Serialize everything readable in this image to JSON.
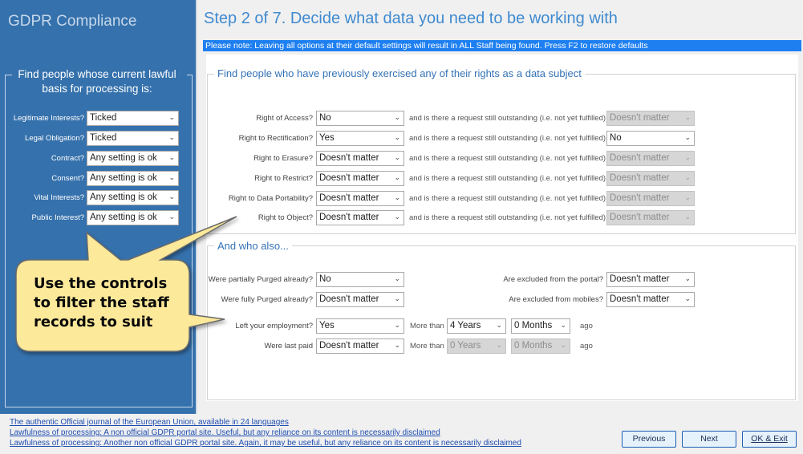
{
  "app": {
    "title": "GDPR Compliance"
  },
  "step": {
    "title": "Step 2 of 7. Decide what data you need to be working with",
    "note": "Please note: Leaving all options at their default settings will result in ALL Staff being found. Press F2 to restore defaults"
  },
  "sidebar": {
    "heading_line1": "Find people whose current lawful",
    "heading_line2": "basis for processing is:",
    "rows": [
      {
        "label": "Legitimate Interests?",
        "value": "Ticked"
      },
      {
        "label": "Legal Obligation?",
        "value": "Ticked"
      },
      {
        "label": "Contract?",
        "value": "Any setting is ok"
      },
      {
        "label": "Consent?",
        "value": "Any setting is ok"
      },
      {
        "label": "Vital Interests?",
        "value": "Any setting is ok"
      },
      {
        "label": "Public Interest?",
        "value": "Any setting is ok"
      }
    ]
  },
  "rights": {
    "title": "Find people who have previously exercised any of their rights as a data subject",
    "outstanding_text": "and is there a request still outstanding (i.e. not yet fulfilled)",
    "rows": [
      {
        "label": "Right of Access?",
        "value": "No",
        "outstanding": "Doesn't matter",
        "outstanding_disabled": true
      },
      {
        "label": "Right to Rectification?",
        "value": "Yes",
        "outstanding": "No",
        "outstanding_disabled": false
      },
      {
        "label": "Right to Erasure?",
        "value": "Doesn't matter",
        "outstanding": "Doesn't matter",
        "outstanding_disabled": true
      },
      {
        "label": "Right to Restrict?",
        "value": "Doesn't matter",
        "outstanding": "Doesn't matter",
        "outstanding_disabled": true
      },
      {
        "label": "Right to Data Portability?",
        "value": "Doesn't matter",
        "outstanding": "Doesn't matter",
        "outstanding_disabled": true
      },
      {
        "label": "Right to Object?",
        "value": "Doesn't matter",
        "outstanding": "Doesn't matter",
        "outstanding_disabled": true
      }
    ]
  },
  "also": {
    "title": "And who also...",
    "partially_purged": {
      "label": "Were partially Purged already?",
      "value": "No"
    },
    "fully_purged": {
      "label": "Were fully Purged already?",
      "value": "Doesn't matter"
    },
    "excluded_portal": {
      "label": "Are excluded from the portal?",
      "value": "Doesn't matter"
    },
    "excluded_mobiles": {
      "label": "Are excluded from mobiles?",
      "value": "Doesn't matter"
    },
    "left_employment": {
      "label": "Left your employment?",
      "value": "Yes",
      "more_than": "More than",
      "years": "4 Years",
      "months": "0 Months",
      "ago": "ago"
    },
    "last_paid": {
      "label": "Were last paid",
      "value": "Doesn't matter",
      "more_than": "More than",
      "years": "0 Years",
      "months": "0 Months",
      "ago": "ago"
    }
  },
  "callout": {
    "line1": "Use the controls",
    "line2": "to filter the staff",
    "line3": "records to suit"
  },
  "links": [
    "The authentic Official journal of the European Union, available in 24 languages",
    "Lawfulness of processing: A non official GDPR portal site. Useful, but any reliance on its content is necessarily disclaimed",
    "Lawfulness of processing: Another non official GDPR portal site. Again, it may be useful, but any reliance on its content is necessarily disclaimed"
  ],
  "buttons": {
    "previous": "Previous",
    "next": "Next",
    "ok_exit": "OK & Exit"
  },
  "icons": {
    "dropdown": "chevron-down-icon"
  },
  "colors": {
    "sidebar": "#3571ac",
    "note_bar": "#1e7ff0",
    "callout_fill": "#fde99a",
    "title": "#3f8ad0"
  }
}
